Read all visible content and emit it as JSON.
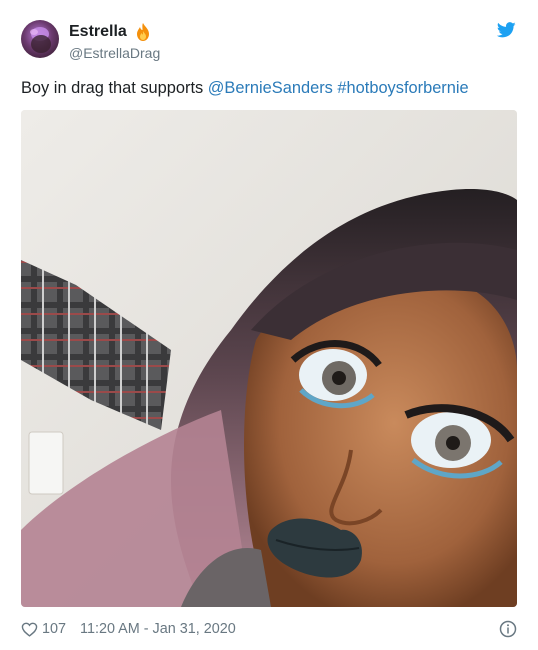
{
  "author": {
    "display_name": "Estrella",
    "name_emoji": "fire-emoji",
    "handle": "@EstrellaDrag"
  },
  "tweet": {
    "text": "Boy in drag that supports ",
    "mention": "@BernieSanders",
    "hashtag": "#hotboysforbernie"
  },
  "footer": {
    "likes": "107",
    "timestamp": "11:20 AM - Jan 31, 2020"
  },
  "icons": {
    "brand": "twitter-bird-icon",
    "like": "heart-icon",
    "info": "info-icon"
  },
  "colors": {
    "link": "#2b7bb9",
    "twitter_blue": "#1da1f2",
    "muted": "#697882",
    "text": "#1c2023"
  }
}
